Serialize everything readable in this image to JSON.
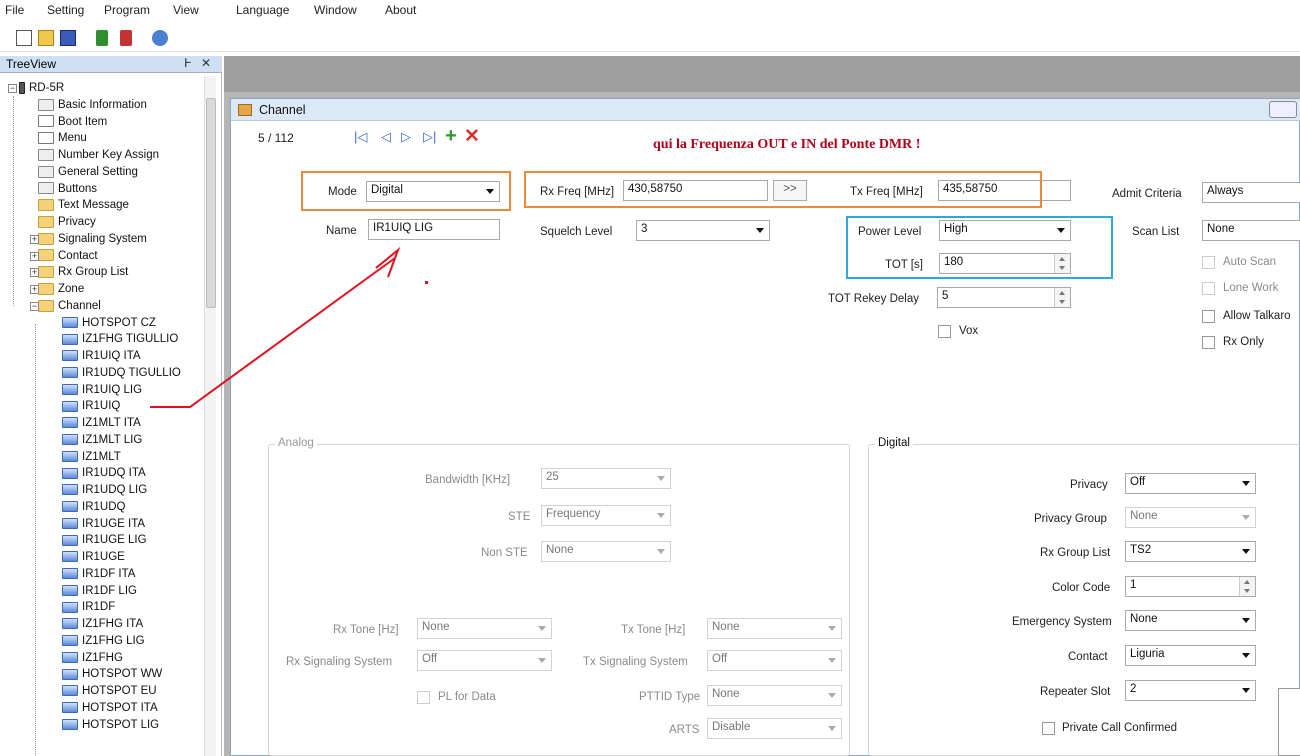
{
  "menu": [
    "File",
    "Setting",
    "Program",
    "View",
    "Language",
    "Window",
    "About"
  ],
  "toolbar_icons": [
    "new-icon",
    "open-icon",
    "save-icon",
    "read-from-radio-icon",
    "write-to-radio-icon",
    "help-icon"
  ],
  "treeview": {
    "title": "TreeView",
    "pin_glyph": "Ͱ",
    "close_glyph": "✕",
    "root": "RD-5R",
    "items": [
      "Basic Information",
      "Boot Item",
      "Menu",
      "Number Key Assign",
      "General Setting",
      "Buttons",
      "Text Message",
      "Privacy",
      "Signaling System",
      "Contact",
      "Rx Group List",
      "Zone",
      "Channel"
    ],
    "channels": [
      "HOTSPOT CZ",
      "IZ1FHG TIGULLIO",
      "IR1UIQ ITA",
      "IR1UDQ TIGULLIO",
      "IR1UIQ LIG",
      "IR1UIQ",
      "IZ1MLT ITA",
      "IZ1MLT LIG",
      "IZ1MLT",
      "IR1UDQ ITA",
      "IR1UDQ LIG",
      "IR1UDQ",
      "IR1UGE ITA",
      "IR1UGE LIG",
      "IR1UGE",
      "IR1DF ITA",
      "IR1DF LIG",
      "IR1DF",
      "IZ1FHG ITA",
      "IZ1FHG LIG",
      "IZ1FHG",
      "HOTSPOT WW",
      "HOTSPOT EU",
      "HOTSPOT ITA",
      "HOTSPOT LIG"
    ]
  },
  "channel_window": {
    "title": "Channel",
    "position": "5 / 112",
    "annotation": "qui  la Frequenza OUT e IN del Ponte  DMR !",
    "mode_label": "Mode",
    "mode_value": "Digital",
    "name_label": "Name",
    "name_value": "IR1UIQ LIG",
    "rx_freq_label": "Rx Freq [MHz]",
    "rx_freq_value": "430,58750",
    "copy_button": ">>",
    "tx_freq_label": "Tx Freq [MHz]",
    "tx_freq_value": "435,58750",
    "squelch_label": "Squelch Level",
    "squelch_value": "3",
    "power_label": "Power Level",
    "power_value": "High",
    "tot_label": "TOT [s]",
    "tot_value": "180",
    "tot_rekey_label": "TOT Rekey Delay",
    "tot_rekey_value": "5",
    "vox_label": "Vox",
    "admit_label": "Admit Criteria",
    "admit_value": "Always",
    "scan_list_label": "Scan List",
    "scan_list_value": "None",
    "auto_scan_label": "Auto Scan",
    "lone_work_label": "Lone Work",
    "allow_talkaround_label": "Allow Talkaro",
    "rx_only_label": "Rx Only",
    "analog": {
      "title": "Analog",
      "bandwidth_label": "Bandwidth [KHz]",
      "bandwidth_value": "25",
      "ste_label": "STE",
      "ste_value": "Frequency",
      "non_ste_label": "Non STE",
      "non_ste_value": "None",
      "rx_tone_label": "Rx Tone [Hz]",
      "rx_tone_value": "None",
      "tx_tone_label": "Tx Tone [Hz]",
      "tx_tone_value": "None",
      "rx_sig_label": "Rx Signaling System",
      "rx_sig_value": "Off",
      "tx_sig_label": "Tx Signaling System",
      "tx_sig_value": "Off",
      "pl_data_label": "PL for Data",
      "pttid_label": "PTTID Type",
      "pttid_value": "None",
      "arts_label": "ARTS",
      "arts_value": "Disable"
    },
    "digital": {
      "title": "Digital",
      "privacy_label": "Privacy",
      "privacy_value": "Off",
      "privacy_group_label": "Privacy Group",
      "privacy_group_value": "None",
      "rx_group_label": "Rx Group List",
      "rx_group_value": "TS2",
      "color_code_label": "Color Code",
      "color_code_value": "1",
      "emergency_label": "Emergency System",
      "emergency_value": "None",
      "contact_label": "Contact",
      "contact_value": "Liguria",
      "repeater_slot_label": "Repeater Slot",
      "repeater_slot_value": "2",
      "private_call_label": "Private Call Confirmed"
    }
  },
  "colors": {
    "annotation_red": "#b00018",
    "highlight_orange": "#ec8a3c",
    "highlight_blue": "#2ea7e0",
    "arrow_red": "#e01020"
  }
}
